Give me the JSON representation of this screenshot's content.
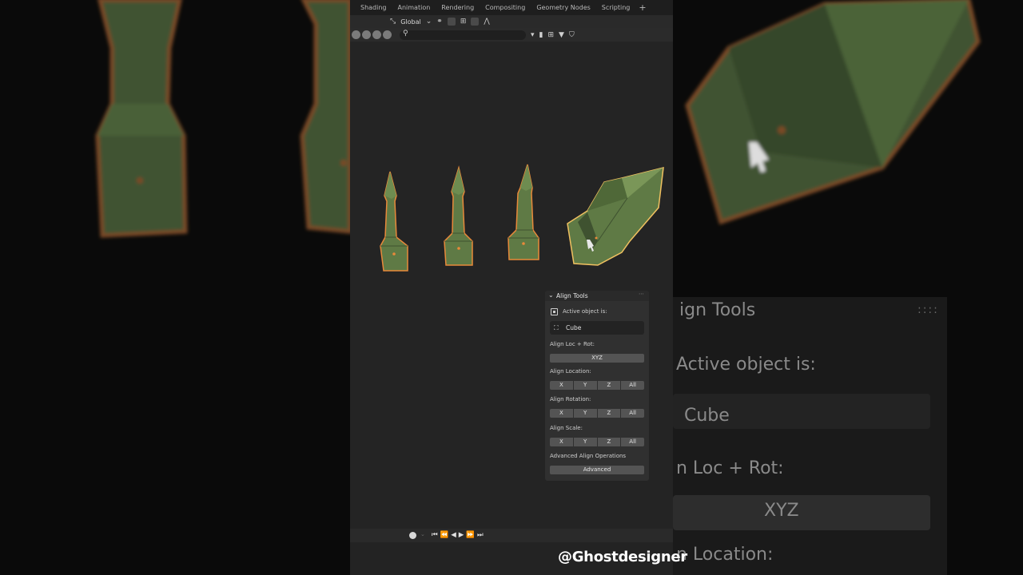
{
  "workspace_tabs": [
    "Shading",
    "Animation",
    "Rendering",
    "Compositing",
    "Geometry Nodes",
    "Scripting",
    "+"
  ],
  "header": {
    "orientation_label": "Global",
    "icons": [
      "transform-orientation-icon",
      "pivot-icon",
      "snap-icon",
      "proportional-edit-icon",
      "falloff-icon"
    ]
  },
  "outliner_header": {
    "search_placeholder": "",
    "icons": [
      "object-icon",
      "restrict-icon",
      "filter-icon",
      "shield-icon"
    ]
  },
  "align_panel": {
    "title": "Align Tools",
    "active_label": "Active object is:",
    "active_object": "Cube",
    "loc_rot_label": "Align Loc + Rot:",
    "loc_rot_button": "XYZ",
    "location_label": "Align Location:",
    "rotation_label": "Align Rotation:",
    "scale_label": "Align Scale:",
    "axes": [
      "X",
      "Y",
      "Z",
      "All"
    ],
    "advanced_label": "Advanced Align Operations",
    "advanced_button": "Advanced"
  },
  "timeline": {
    "buttons": [
      "⏮",
      "⏪",
      "◀",
      "▶",
      "⏩",
      "⏭"
    ]
  },
  "background_zoom": {
    "title": "ign Tools",
    "active_label": "Active object is:",
    "active_object": "Cube",
    "loc_rot_label": "n Loc + Rot:",
    "loc_rot_button": "XYZ",
    "location_label": "n Location:"
  },
  "watermark": "@Ghostdesigner",
  "colors": {
    "mesh_fill": "#5f7a45",
    "mesh_outline": "#e8893a",
    "active_outline": "#f0c060",
    "panel_bg": "#303030",
    "button_bg": "#545454"
  }
}
